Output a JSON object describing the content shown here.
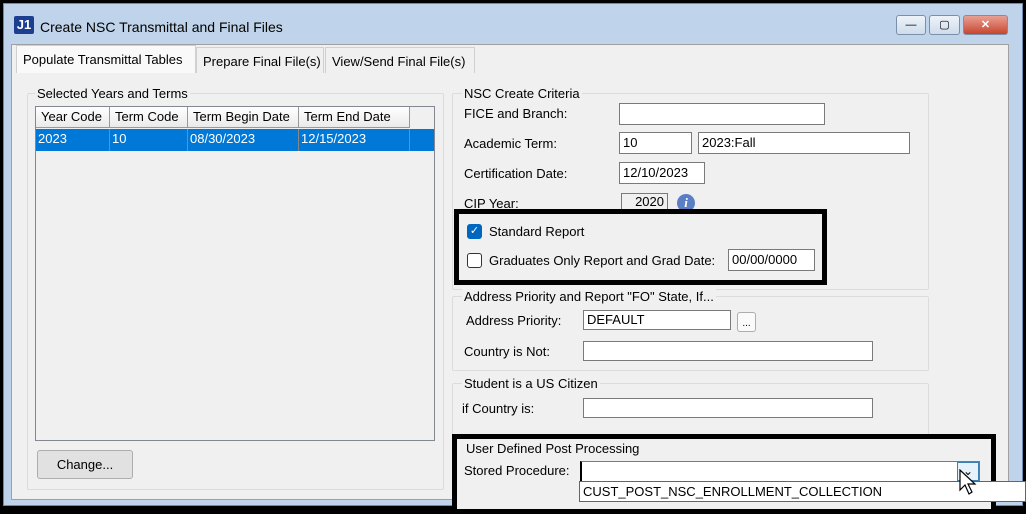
{
  "window": {
    "title": "Create NSC Transmittal and Final Files",
    "logo": "J1",
    "buttons": {
      "minimize": "—",
      "maximize": "▢",
      "close": "✕"
    }
  },
  "tabs": [
    {
      "label": "Populate Transmittal Tables",
      "active": true
    },
    {
      "label": "Prepare Final File(s)"
    },
    {
      "label": "View/Send Final File(s)"
    }
  ],
  "left": {
    "group_label": "Selected Years and Terms",
    "columns": [
      "Year Code",
      "Term Code",
      "Term Begin Date",
      "Term End Date"
    ],
    "rows": [
      [
        "2023",
        "10",
        "08/30/2023",
        "12/15/2023"
      ]
    ],
    "change_button": "Change..."
  },
  "criteria": {
    "group_label": "NSC Create Criteria",
    "fice_label": "FICE and Branch:",
    "fice_value": "",
    "term_label": "Academic Term:",
    "term_code": "10",
    "term_desc": "2023:Fall",
    "cert_label": "Certification Date:",
    "cert_value": "12/10/2023",
    "cip_label": "CIP Year:",
    "cip_value": "2020",
    "info_icon": "i",
    "standard_label": "Standard Report",
    "standard_checked": true,
    "grad_label": "Graduates Only Report and Grad Date:",
    "grad_checked": false,
    "grad_date": "00/00/0000"
  },
  "address": {
    "group_label": "Address Priority and Report \"FO\" State, If...",
    "priority_label": "Address Priority:",
    "priority_value": "DEFAULT",
    "lookup_button": "...",
    "country_not_label": "Country is Not:",
    "country_not_value": ""
  },
  "citizen": {
    "group_label": "Student is a US Citizen",
    "country_label": "if Country is:",
    "country_value": ""
  },
  "post": {
    "group_label": "User Defined Post Processing",
    "sp_label": "Stored Procedure:",
    "sp_value": "",
    "dropdown_icon": "⌄",
    "options": [
      "CUST_POST_NSC_ENROLLMENT_COLLECTION"
    ]
  }
}
